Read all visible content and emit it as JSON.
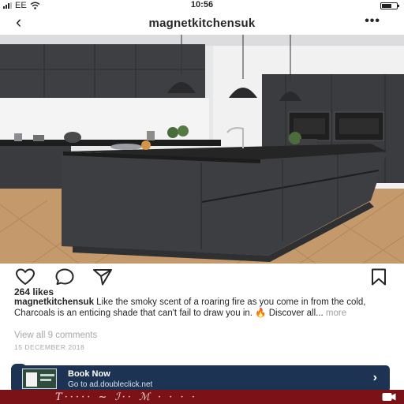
{
  "status_bar": {
    "carrier": "EE",
    "time": "10:56"
  },
  "header": {
    "back_icon": "chevron-left-icon",
    "title": "magnetkitchensuk",
    "more_icon": "ellipsis-icon",
    "more_glyph": "•••"
  },
  "post": {
    "image_description": "kitchen-photo",
    "actions": {
      "like_icon": "heart-icon",
      "comment_icon": "comment-icon",
      "share_icon": "paper-plane-icon",
      "save_icon": "bookmark-icon"
    },
    "likes": "264 likes",
    "caption": {
      "username": "magnetkitchensuk",
      "text": " Like the smoky scent of a roaring fire as you come in from the cold, Charcoals is an enticing shade that can't fail to draw you in. 🔥 Discover all...",
      "more": " more"
    },
    "view_comments": "View all 9 comments",
    "date": "15 DECEMBER 2018"
  },
  "ad": {
    "title": "Book Now",
    "url": "Go to ad.doubleclick.net",
    "chevron": "›",
    "colors": {
      "background": "#1c3354",
      "text": "#ffffff"
    }
  },
  "bottom_strip": {
    "script_text": "T····· ~ ℐ·· ℳ · · · ·",
    "video_icon": "video-camera-icon",
    "color": "#7a1217"
  }
}
